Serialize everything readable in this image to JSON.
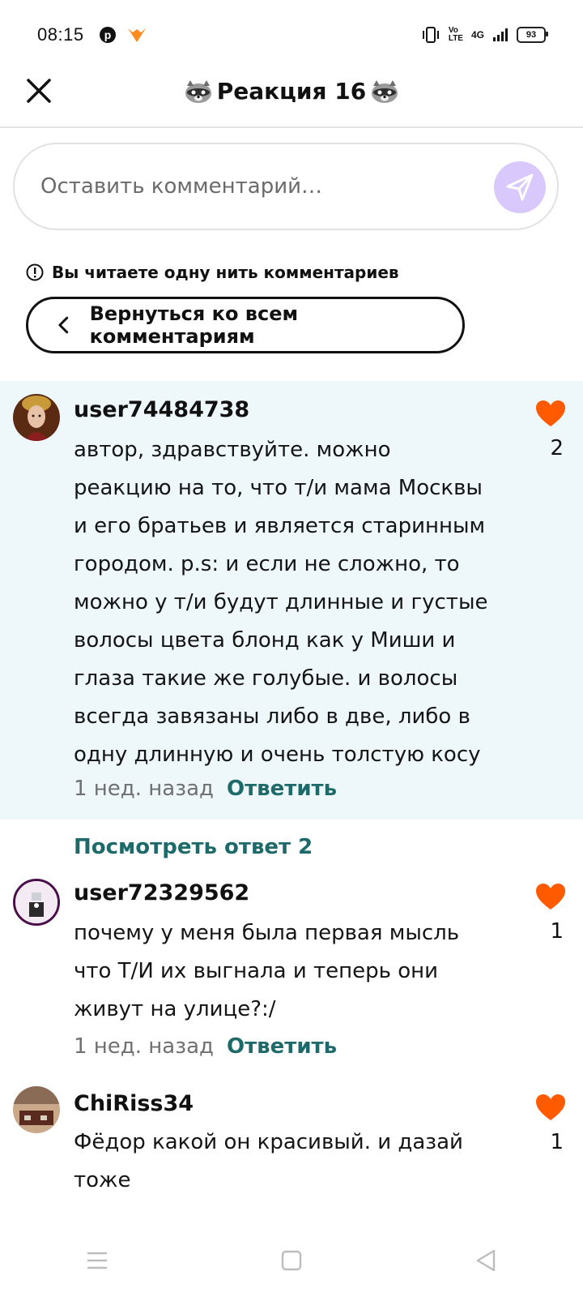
{
  "status_bar": {
    "time": "08:15",
    "app_icons": [
      "pinterest-icon",
      "vpn-fox-icon"
    ],
    "network_label": "4G",
    "battery": "93"
  },
  "header": {
    "title": "Реакция 16",
    "close_icon": "close-icon",
    "title_decor_icon": "raccoon-icon"
  },
  "compose": {
    "placeholder": "Оставить комментарий…",
    "send_icon": "send-icon"
  },
  "thread": {
    "notice": "Вы читаете одну нить комментариев",
    "back_label": "Вернуться ко всем комментариям"
  },
  "comments": [
    {
      "username": "user74484738",
      "text": "автор, здравствуйте. можно реакцию на то, что т/и мама Москвы и его братьев и является старинным городом. p.s: и если не сложно, то можно у т/и будут длинные и густые волосы цвета блонд как у Миши и глаза такие же голубые. и волосы всегда завязаны либо в две, либо в одну длинную и очень толстую косу",
      "time": "1 нед. назад",
      "reply_label": "Ответить",
      "likes": "2"
    },
    {
      "username": "user72329562",
      "text": "почему у меня была первая мысль что Т/И их выгнала и теперь они живут на улице?:/",
      "time": "1 нед. назад",
      "reply_label": "Ответить",
      "likes": "1"
    },
    {
      "username": "ChiRiss34",
      "text": "Фёдор какой он красивый. и дазай тоже",
      "likes": "1"
    }
  ],
  "view_replies_label": "Посмотреть ответ 2",
  "colors": {
    "accent_teal": "#1e6a6a",
    "like_orange": "#ff5a00",
    "send_bg": "#d9c8fb",
    "highlight_bg": "#eef8fb"
  }
}
